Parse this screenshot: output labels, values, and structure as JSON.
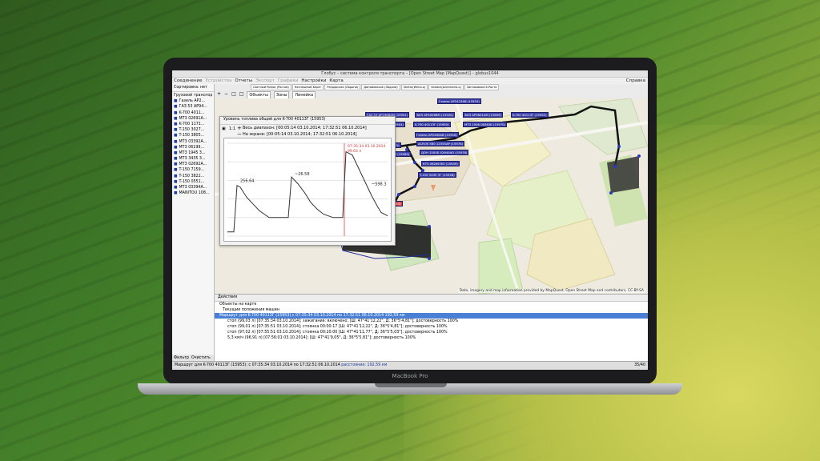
{
  "window": {
    "title": "Глобус – система контроля транспорта – [Open Street Map (MapQuest)] – globus1044"
  },
  "menu": {
    "items": [
      "Соединение",
      "Устройства",
      "Отчеты",
      "Экспорт",
      "Графики",
      "Настройки",
      "Карта"
    ],
    "help": "Справка"
  },
  "sidebar": {
    "sort_label": "Сортировка: нет",
    "group": "Грузовой транспорт",
    "items": [
      "Газель AP2...",
      "ГАЗ 53 AP94...",
      "K-700 4011...",
      "MT3 02691A...",
      "K-700 1171...",
      "T-150 3027...",
      "T-150 3805...",
      "MT3 03392A...",
      "MT3 06199...",
      "MT3 1945 3...",
      "MT3 3435 3...",
      "MT3 02692A...",
      "T-150 7159...",
      "T-150 3822...",
      "T-150 0551...",
      "MT3 03394A...",
      "MANITOU 108..."
    ],
    "filter_label": "Фильтр",
    "clear_label": "Очистить"
  },
  "map_tabs": [
    "Светлый Рынок (Ростов)",
    "Неспешный Берег",
    "Раздорская (Ладони)",
    "Динамовское (Ладани)",
    "Sentar(Wnha.o)",
    "Seadne(Aznhelaria.o)",
    "Заплакивакте-Роста"
  ],
  "map_tool_tabs": {
    "objects": "Объекты",
    "zones": "Зоны",
    "ruler": "Линейка"
  },
  "chart": {
    "title": "Уровень топлива общий для K-700 40113Г (15953)",
    "scale": "1:1",
    "full_range": "Весь диапазон: [00:05:14 03.10.2014; 17:32:51 06.10.2014]",
    "on_screen": "На экране: [00:05:14 03.10.2014; 17:32:51 06.10.2014]",
    "cursor_time": "07:35:34 03.10.2014",
    "cursor_value": "99.03 л",
    "labels": [
      "256.64",
      "~26.58",
      "~598.3"
    ]
  },
  "chart_data": {
    "type": "line",
    "x": [
      0,
      4,
      6,
      8,
      12,
      16,
      20,
      26,
      30,
      34,
      38,
      40,
      44,
      48,
      52,
      56,
      60,
      66,
      70,
      72,
      74,
      78,
      82,
      86,
      90,
      94,
      96,
      100
    ],
    "values": [
      5,
      5,
      60,
      58,
      46,
      38,
      30,
      22,
      22,
      22,
      22,
      70,
      62,
      52,
      40,
      32,
      26,
      22,
      22,
      22,
      100,
      96,
      80,
      64,
      48,
      34,
      28,
      24
    ],
    "ylim": [
      0,
      110
    ]
  },
  "vehicles": [
    {
      "label": "Газель AP2423АВ (15933)",
      "red": false
    },
    {
      "label": "ГАЗ 53 AP1968АМ (15901)",
      "red": false
    },
    {
      "label": "ЗИЛ AP4006ВМ (15900)",
      "red": false
    },
    {
      "label": "ЗИЛ AP5601АМ (15899)",
      "red": false
    },
    {
      "label": "K-700 40113Г (15952)",
      "red": false
    },
    {
      "label": "ЗИЛ AP5061АМ (15904)",
      "red": false
    },
    {
      "label": "K-700 40113Г (15950)",
      "red": false
    },
    {
      "label": "МТЗ 1508 08363Б (15970)",
      "red": false
    },
    {
      "label": "ГАЗ 7151 (15905)",
      "red": false
    },
    {
      "label": "Газель AP2460АВ (15928)",
      "red": false
    },
    {
      "label": "Claas Mega 360 (15975)",
      "red": false
    },
    {
      "label": "ACROS 580 12555АР (15978)",
      "red": false
    },
    {
      "label": "ЗИЛ 9062 80 (15969)",
      "red": false
    },
    {
      "label": "ДОН 1500Б 02640АО (15978)",
      "red": false
    },
    {
      "label": "КТЗ 06268 ВО (15949)",
      "red": false
    },
    {
      "label": "T-150 3435 3Г (15948)",
      "red": false
    },
    {
      "label": "K-700 40113Г (15953)",
      "red": true
    }
  ],
  "map_copyright": "Data, imagery and map information provided by MapQuest, Open Street Map and contributors, CC-BY-SA",
  "actions": {
    "title": "Действия",
    "objects_label": "Объекты на карте",
    "current_positions": "Текущие положения машин",
    "route": "Маршрут для K-700 40113Г (15953) с 07:35:34 03.10.2014 по 17:32:51 06.10.2014 192,59 км",
    "rows": [
      "стоп (99,03 л) [07:35:34 03.10.2014]; зажигание: включено; [Ш: 47°41'12,22\", Д: 36°5'4,81\"]; достоверность 100%",
      "стоп (99,01 л) [07:35:51 03.10.2014]; стоянка 00:00:17 [Ш: 47°41'12,22\", Д: 36°5'4,81\"]; достоверность 100%",
      "стоп (97,02 л) [07:55:51 03.10.2014]; стоянка 00:20:00 [Ш: 47°41'11,77\", Д: 36°5'5,03\"]; достоверность 100%",
      "5,3 км/ч (96,91 л) [07:56:01 03.10.2014]; [Ш: 47°41'9,05\", Д: 36°5'5,81\"]; достоверность 100%"
    ]
  },
  "status": {
    "route": "Маршрут для K-700 40113Г (15953): с 07:35:34 03.10.2014 по 17:32:51 06.10.2014",
    "distance_label": "расстояние: 192,59 км",
    "page": "35/40"
  },
  "laptop": {
    "brand": "MacBook Pro"
  }
}
